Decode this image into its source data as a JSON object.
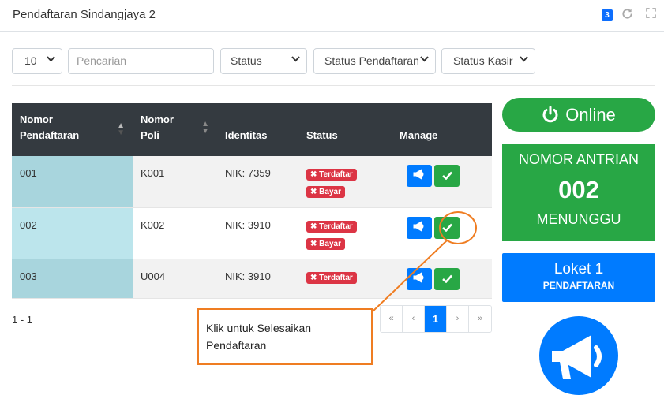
{
  "header": {
    "title": "Pendaftaran Sindangjaya 2",
    "badge": "3",
    "refresh_icon": "refresh-icon",
    "expand_icon": "expand-icon"
  },
  "filters": {
    "per_page": "10",
    "search_placeholder": "Pencarian",
    "status": "Status",
    "status_pendaftaran": "Status Pendaftaran",
    "status_kasir": "Status Kasir"
  },
  "table": {
    "headers": {
      "nomor_pendaftaran": [
        "Nomor",
        "Pendaftaran"
      ],
      "nomor_poli": [
        "Nomor",
        "Poli"
      ],
      "identitas": "Identitas",
      "status": "Status",
      "manage": "Manage"
    },
    "rows": [
      {
        "nomor": "001",
        "poli": "K001",
        "identitas": "NIK: 7359",
        "badges": [
          "Terdaftar",
          "Bayar"
        ]
      },
      {
        "nomor": "002",
        "poli": "K002",
        "identitas": "NIK: 3910",
        "badges": [
          "Terdaftar",
          "Bayar"
        ]
      },
      {
        "nomor": "003",
        "poli": "U004",
        "identitas": "NIK: 3910",
        "badges": [
          "Terdaftar"
        ]
      }
    ],
    "range": "1 - 1"
  },
  "pagination": {
    "first": "«",
    "prev": "‹",
    "current": "1",
    "next": "›",
    "last": "»"
  },
  "callout": {
    "text_line1": "Klik untuk Selesaikan",
    "text_line2": "Pendaftaran"
  },
  "side": {
    "online_label": "Online",
    "queue_title": "NOMOR ANTRIAN",
    "queue_number": "002",
    "queue_status": "MENUNGGU",
    "loket_title": "Loket 1",
    "loket_sub": "PENDAFTARAN"
  },
  "colors": {
    "green": "#28a745",
    "blue": "#007bff",
    "red": "#dc3545",
    "dark": "#343a40",
    "orange": "#ef7d22"
  }
}
